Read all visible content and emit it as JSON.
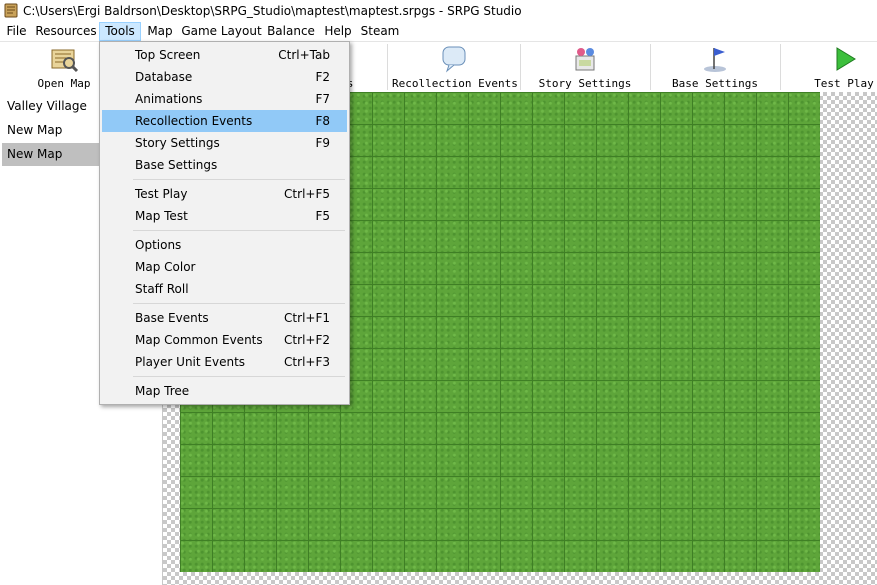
{
  "window": {
    "title": "C:\\Users\\Ergi Baldrson\\Desktop\\SRPG_Studio\\maptest\\maptest.srpgs - SRPG Studio"
  },
  "menubar": {
    "items": [
      "File",
      "Resources",
      "Tools",
      "Map",
      "Game Layout",
      "Balance",
      "Help",
      "Steam"
    ],
    "open_item": "Tools"
  },
  "toolbar": {
    "buttons": [
      {
        "label": "Open Map",
        "icon": "open-map-icon"
      },
      {
        "label": "s",
        "icon": ""
      },
      {
        "label": "Recollection Events",
        "icon": "recollection-events-icon"
      },
      {
        "label": "Story Settings",
        "icon": "story-settings-icon"
      },
      {
        "label": "Base Settings",
        "icon": "base-settings-icon"
      },
      {
        "label": "Test Play",
        "icon": "test-play-icon"
      }
    ]
  },
  "sidebar": {
    "items": [
      {
        "label": "Valley Village",
        "selected": false
      },
      {
        "label": "New Map",
        "selected": false
      },
      {
        "label": "New Map",
        "selected": true
      }
    ]
  },
  "tools_menu": {
    "items": [
      {
        "label": "Top Screen",
        "shortcut": "Ctrl+Tab"
      },
      {
        "label": "Database",
        "shortcut": "F2"
      },
      {
        "label": "Animations",
        "shortcut": "F7"
      },
      {
        "label": "Recollection Events",
        "shortcut": "F8",
        "highlighted": true
      },
      {
        "label": "Story Settings",
        "shortcut": "F9"
      },
      {
        "label": "Base Settings",
        "shortcut": ""
      },
      {
        "label": "Test Play",
        "shortcut": "Ctrl+F5"
      },
      {
        "label": "Map Test",
        "shortcut": "F5"
      },
      {
        "label": "Options",
        "shortcut": ""
      },
      {
        "label": "Map Color",
        "shortcut": ""
      },
      {
        "label": "Staff Roll",
        "shortcut": ""
      },
      {
        "label": "Base Events",
        "shortcut": "Ctrl+F1"
      },
      {
        "label": "Map Common Events",
        "shortcut": "Ctrl+F2"
      },
      {
        "label": "Player Unit Events",
        "shortcut": "Ctrl+F3"
      },
      {
        "label": "Map Tree",
        "shortcut": ""
      }
    ]
  },
  "colors": {
    "grass": "#5ea53a",
    "menu_highlight": "#91c9f7",
    "sidebar_selected": "#bfbfbf"
  }
}
